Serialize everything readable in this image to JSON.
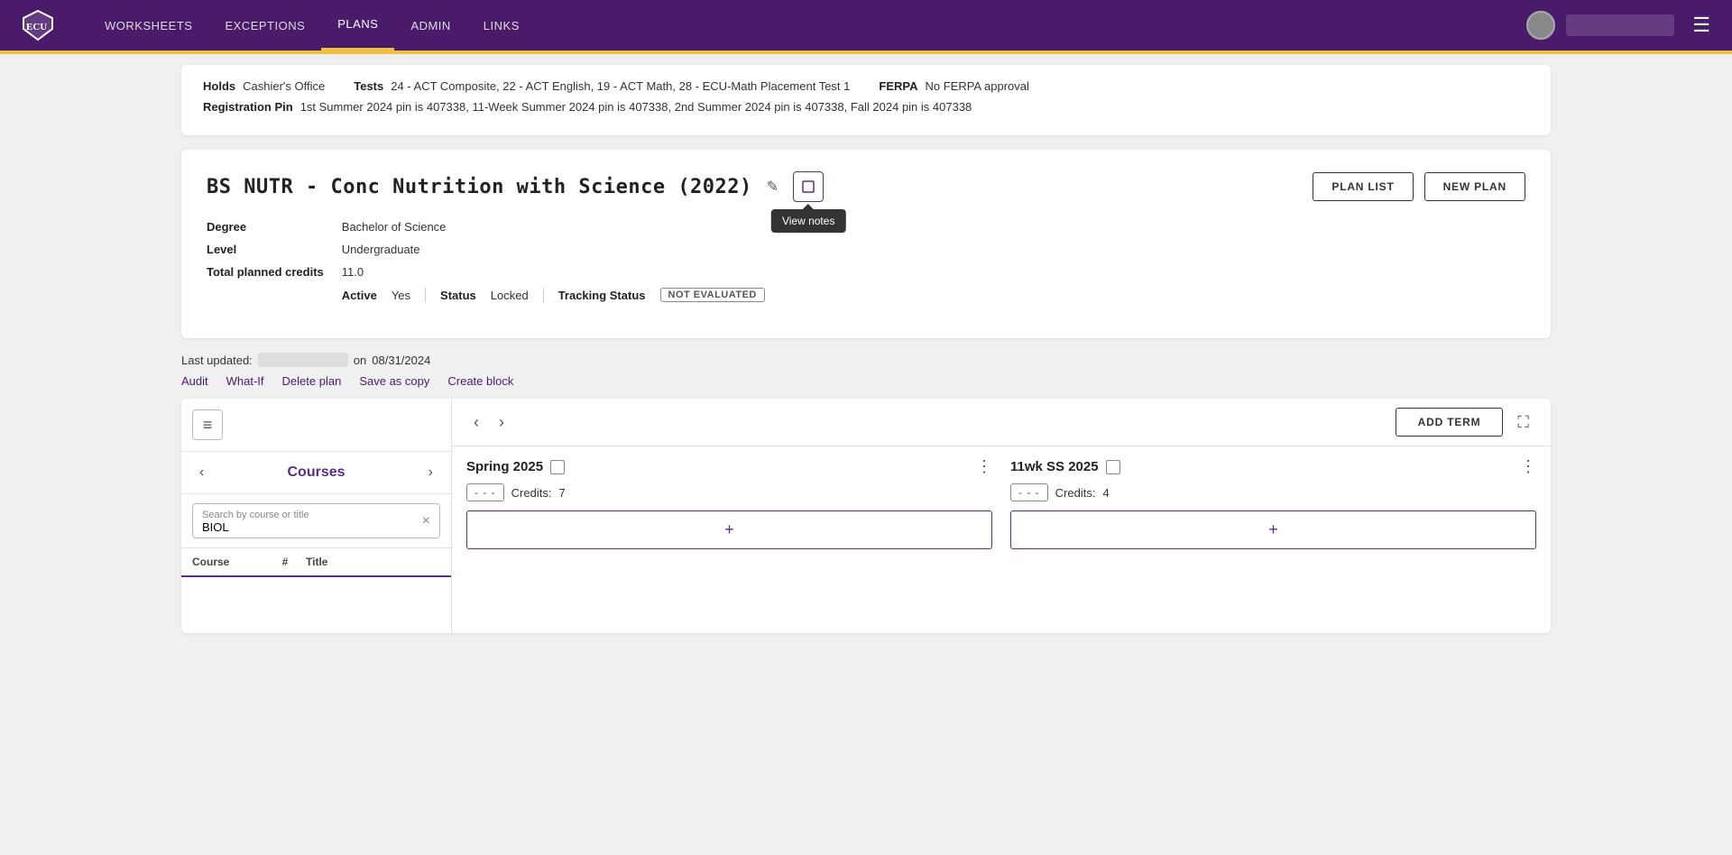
{
  "nav": {
    "logo_text": "ECU",
    "links": [
      {
        "label": "WORKSHEETS",
        "active": false
      },
      {
        "label": "EXCEPTIONS",
        "active": false
      },
      {
        "label": "PLANS",
        "active": true
      },
      {
        "label": "ADMIN",
        "active": false
      },
      {
        "label": "LINKS",
        "active": false
      }
    ],
    "username_placeholder": "",
    "menu_icon": "☰"
  },
  "info_card": {
    "holds_label": "Holds",
    "holds_value": "Cashier's Office",
    "tests_label": "Tests",
    "tests_value": "24 - ACT Composite, 22 - ACT English, 19 - ACT Math, 28 - ECU-Math Placement Test 1",
    "ferpa_label": "FERPA",
    "ferpa_value": "No FERPA approval",
    "reg_pin_label": "Registration Pin",
    "reg_pin_value": "1st Summer 2024 pin is 407338, 11-Week Summer 2024 pin is 407338, 2nd Summer 2024 pin is 407338, Fall 2024 pin is 407338"
  },
  "plan_card": {
    "title": "BS NUTR - Conc Nutrition with Science (2022)",
    "pencil_icon": "✎",
    "notes_icon": "□",
    "view_notes_tooltip": "View notes",
    "plan_list_btn": "PLAN LIST",
    "new_plan_btn": "NEW PLAN",
    "degree_label": "Degree",
    "degree_value": "Bachelor of Science",
    "level_label": "Level",
    "level_value": "Undergraduate",
    "credits_label": "Total planned credits",
    "credits_value": "11.0",
    "active_label": "Active",
    "active_value": "Yes",
    "status_label": "Status",
    "status_value": "Locked",
    "tracking_label": "Tracking Status",
    "tracking_value": "NOT EVALUATED"
  },
  "plan_footer": {
    "last_updated_label": "Last updated:",
    "last_updated_on": "on",
    "last_updated_date": "08/31/2024",
    "audit_link": "Audit",
    "whatif_link": "What-If",
    "delete_link": "Delete plan",
    "save_link": "Save as copy",
    "block_link": "Create block"
  },
  "planner": {
    "hamburger_label": "≡",
    "courses_title": "Courses",
    "search_placeholder": "Search by course or title",
    "search_value": "BIOL",
    "search_clear": "×",
    "col_course": "Course",
    "col_num": "#",
    "col_title": "Title",
    "prev_btn": "‹",
    "next_btn": "›",
    "add_term_btn": "ADD TERM",
    "expand_btn": "⛶",
    "terms": [
      {
        "id": "spring-2025",
        "title": "Spring 2025",
        "credits_label": "Credits:",
        "credits_value": "7",
        "credits_box": "- - -"
      },
      {
        "id": "11wk-ss-2025",
        "title": "11wk SS 2025",
        "credits_label": "Credits:",
        "credits_value": "4",
        "credits_box": "- - -"
      }
    ],
    "add_course_icon": "+"
  }
}
